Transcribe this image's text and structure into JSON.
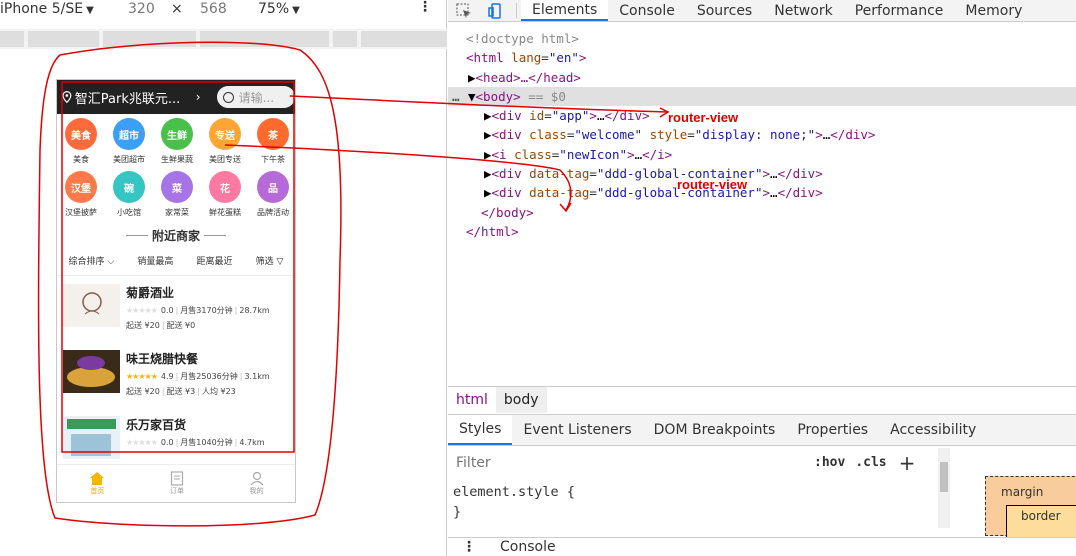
{
  "device_toolbar": {
    "device": "iPhone 5/SE",
    "width": "320",
    "times": "×",
    "height": "568",
    "zoom": "75%",
    "more": "⋮"
  },
  "phone": {
    "location": "智汇Park兆联元...",
    "search_placeholder": "请输...",
    "categories": [
      {
        "icon_text": "美食",
        "label": "美食",
        "color": "#ff6a3d"
      },
      {
        "icon_text": "超市",
        "label": "美团超市",
        "color": "#3ba0f5"
      },
      {
        "icon_text": "生鲜",
        "label": "生鲜果蔬",
        "color": "#48c04a"
      },
      {
        "icon_text": "专送",
        "label": "美团专送",
        "color": "#ffa534"
      },
      {
        "icon_text": "茶",
        "label": "下午茶",
        "color": "#ff6a2e"
      },
      {
        "icon_text": "汉堡",
        "label": "汉堡披萨",
        "color": "#ff7a4a"
      },
      {
        "icon_text": "碗",
        "label": "小吃馆",
        "color": "#35c6c4"
      },
      {
        "icon_text": "菜",
        "label": "家常菜",
        "color": "#a774e8"
      },
      {
        "icon_text": "花",
        "label": "鲜花蛋糕",
        "color": "#ff7aa2"
      },
      {
        "icon_text": "品",
        "label": "品牌活动",
        "color": "#b56ad6"
      }
    ],
    "nearby_title": "附近商家",
    "sort_options": [
      "综合排序",
      "销量最高",
      "距离最近",
      "筛选"
    ],
    "shops": [
      {
        "name": "菊爵酒业",
        "rating": "0.0",
        "monthly_sales": "月售31",
        "delivery_time": "70分钟",
        "distance": "28.7km",
        "min_order": "起送 ¥20",
        "delivery_fee": "配送 ¥0",
        "per_capita": "",
        "stars_filled": 0
      },
      {
        "name": "味王烧腊快餐",
        "rating": "4.9",
        "monthly_sales": "月售250",
        "delivery_time": "36分钟",
        "distance": "3.1km",
        "min_order": "起送 ¥20",
        "delivery_fee": "配送 ¥3",
        "per_capita": "人均 ¥23",
        "stars_filled": 5
      },
      {
        "name": "乐万家百货",
        "rating": "0.0",
        "monthly_sales": "月售10",
        "delivery_time": "40分钟",
        "distance": "4.7km",
        "min_order": "",
        "delivery_fee": "",
        "per_capita": "",
        "stars_filled": 0
      }
    ],
    "tabbar": [
      "首页",
      "订单",
      "我的"
    ]
  },
  "annotations": {
    "label_1": "router-view",
    "label_2": "router-view",
    "color": "#e00000"
  },
  "devtools": {
    "tabs": [
      "Elements",
      "Console",
      "Sources",
      "Network",
      "Performance",
      "Memory"
    ],
    "active_tab": "Elements",
    "dom": {
      "doctype": "<!doctype html>",
      "html_open_tag": "<html",
      "html_lang_attr": "lang",
      "html_lang_val": "\"en\"",
      "head": "<head>…</head>",
      "body_tag": "<body>",
      "body_eq": "== $0",
      "div_app_attr": "id",
      "div_app_val": "\"app\"",
      "div_welcome_class": "class",
      "div_welcome_class_val": "\"welcome\"",
      "div_welcome_style": "style",
      "div_welcome_style_val": "\"display: none;\"",
      "i_class": "class",
      "i_class_val": "\"newIcon\"",
      "ddd_attr": "data-tag",
      "ddd_val": "\"ddd-global-container\"",
      "body_close": "</body>",
      "html_close": "</html>"
    },
    "breadcrumbs": [
      "html",
      "body"
    ],
    "sub_tabs": [
      "Styles",
      "Event Listeners",
      "DOM Breakpoints",
      "Properties",
      "Accessibility"
    ],
    "filter_placeholder": "Filter",
    "hov": ":hov",
    "cls": ".cls",
    "plus": "+",
    "element_style_open": "element.style {",
    "element_style_close": "}",
    "box_margin": "margin",
    "box_border": "border",
    "console_label": "Console"
  }
}
